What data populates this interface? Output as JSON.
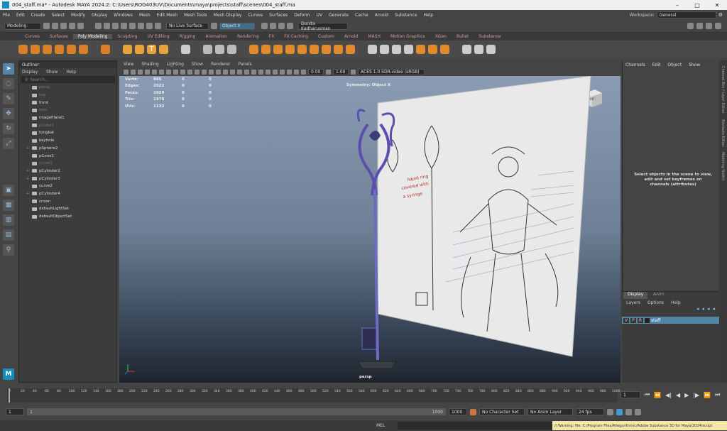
{
  "window": {
    "title": "004_staff.ma* - Autodesk MAYA 2024.2: C:\\Users\\ROG403UV\\Documents\\maya\\projects\\staff\\scenes\\004_staff.ma"
  },
  "menubar": {
    "items": [
      "File",
      "Edit",
      "Create",
      "Select",
      "Modify",
      "Display",
      "Windows",
      "Mesh",
      "Edit Mesh",
      "Mesh Tools",
      "Mesh Display",
      "Curves",
      "Surfaces",
      "Deform",
      "UV",
      "Generate",
      "Cache",
      "Arnold",
      "Substance",
      "Help"
    ],
    "workspace_label": "Workspace:",
    "workspace_value": "General"
  },
  "statusline": {
    "mode": "Modeling",
    "live_surface": "No Live Surface",
    "object_mode": "Object X",
    "user": "Donita Kadharusman"
  },
  "shelf": {
    "tabs": [
      "Curves",
      "Surfaces",
      "Poly Modeling",
      "Sculpting",
      "UV Editing",
      "Rigging",
      "Animation",
      "Rendering",
      "FX",
      "FX Caching",
      "Custom",
      "Arnold",
      "MASH",
      "Motion Graphics",
      "XGen",
      "Bullet",
      "Substance"
    ],
    "active_tab": "Poly Modeling"
  },
  "outliner": {
    "title": "Outliner",
    "menu": [
      "Display",
      "Show",
      "Help"
    ],
    "search_placeholder": "Search...",
    "items": [
      {
        "label": "persp",
        "dim": true,
        "expand": ""
      },
      {
        "label": "top",
        "dim": true,
        "expand": ""
      },
      {
        "label": "front",
        "dim": false,
        "expand": ""
      },
      {
        "label": "side",
        "dim": true,
        "expand": ""
      },
      {
        "label": "imagePlane1",
        "dim": false,
        "expand": ""
      },
      {
        "label": "pCube1",
        "dim": true,
        "expand": ""
      },
      {
        "label": "tongkat",
        "dim": false,
        "expand": ""
      },
      {
        "label": "keyhole",
        "dim": false,
        "expand": ""
      },
      {
        "label": "pSphere2",
        "dim": false,
        "expand": "+"
      },
      {
        "label": "pCone1",
        "dim": false,
        "expand": ""
      },
      {
        "label": "curve1",
        "dim": true,
        "expand": ""
      },
      {
        "label": "pCylinder2",
        "dim": false,
        "expand": "+"
      },
      {
        "label": "pCylinder3",
        "dim": false,
        "expand": "+"
      },
      {
        "label": "curve2",
        "dim": false,
        "expand": ""
      },
      {
        "label": "pCylinder4",
        "dim": false,
        "expand": "+"
      },
      {
        "label": "crown",
        "dim": false,
        "expand": ""
      },
      {
        "label": "defaultLightSet",
        "dim": false,
        "expand": ""
      },
      {
        "label": "defaultObjectSet",
        "dim": false,
        "expand": ""
      }
    ]
  },
  "viewport": {
    "menu": [
      "View",
      "Shading",
      "Lighting",
      "Show",
      "Renderer",
      "Panels"
    ],
    "exposure": "0.00",
    "gamma": "1.00",
    "colorspace": "ACES 1.0 SDR-video (sRGB)",
    "stats": [
      {
        "label": "Verts:",
        "v": "880",
        "a": "0",
        "b": "0"
      },
      {
        "label": "Edges:",
        "v": "2022",
        "a": "0",
        "b": "0"
      },
      {
        "label": "Faces:",
        "v": "1029",
        "a": "0",
        "b": "0"
      },
      {
        "label": "Tris:",
        "v": "1978",
        "a": "0",
        "b": "0"
      },
      {
        "label": "UVs:",
        "v": "1132",
        "a": "0",
        "b": "0"
      }
    ],
    "symmetry": "Symmetry: Object X",
    "camera": "persp",
    "cube_label": "FRONT",
    "note": "liquid ring\ncovered with\na syringe"
  },
  "channelbox": {
    "menu": [
      "Channels",
      "Edit",
      "Object",
      "Show"
    ],
    "hint": "Select objects in the scene to view, edit and set keyframes on channels (attributes)"
  },
  "layers": {
    "tabs": [
      "Display",
      "Anim"
    ],
    "menu": [
      "Layers",
      "Options",
      "Help"
    ],
    "layer": {
      "v": "V",
      "p": "P",
      "r": "R",
      "name": "staff"
    }
  },
  "sidetabs": [
    "Channel Box / Layer Editor",
    "Attribute Editor",
    "Modeling Toolkit"
  ],
  "timeslider": {
    "ticks": [
      "0",
      "20",
      "40",
      "60",
      "80",
      "100",
      "120",
      "140",
      "160",
      "180",
      "200",
      "220",
      "240",
      "260",
      "280",
      "300",
      "320",
      "340",
      "360",
      "380",
      "400",
      "420",
      "440",
      "460",
      "480",
      "500",
      "520",
      "540",
      "560",
      "580",
      "600",
      "620",
      "640",
      "660",
      "680",
      "700",
      "720",
      "740",
      "760",
      "780",
      "800",
      "820",
      "840",
      "860",
      "880",
      "900",
      "920",
      "940",
      "960",
      "980",
      "1000"
    ],
    "current": "1",
    "progress": 0.0
  },
  "rangeslider": {
    "start": "1",
    "range_start": "1",
    "range_end": "1000",
    "end": "1000",
    "character_set": "No Character Set",
    "anim_layer": "No Anim Layer",
    "fps": "24 fps"
  },
  "cmdline": {
    "lang": "MEL",
    "warning": "// Warning: file: C:/Program Files/Allegorithmic/Adobe Substance 3D for Maya/2024/script"
  }
}
